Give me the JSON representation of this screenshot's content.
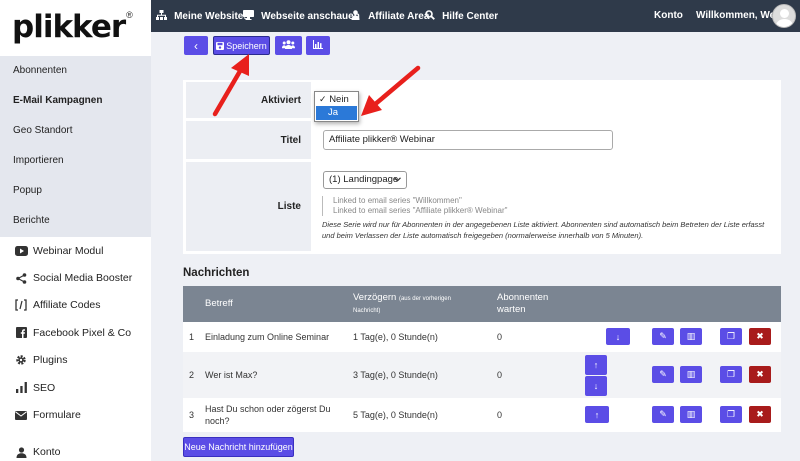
{
  "brand": {
    "logo_text": "plikker",
    "logo_mark": "®"
  },
  "sidebar": {
    "sub_items": [
      {
        "label": "Abonnenten"
      },
      {
        "label": "E-Mail Kampagnen",
        "active": true
      },
      {
        "label": "Geo Standort"
      },
      {
        "label": "Importieren"
      },
      {
        "label": "Popup"
      },
      {
        "label": "Berichte"
      }
    ],
    "main_items": [
      {
        "label": "Webinar Modul",
        "icon": "youtube-icon"
      },
      {
        "label": "Social Media Booster",
        "icon": "share-icon"
      },
      {
        "label": "Affiliate Codes",
        "icon": "brackets-icon"
      },
      {
        "label": "Facebook Pixel & Co",
        "icon": "facebook-icon"
      },
      {
        "label": "Plugins",
        "icon": "gear-icon"
      },
      {
        "label": "SEO",
        "icon": "bar-chart-icon"
      },
      {
        "label": "Formulare",
        "icon": "envelope-icon"
      },
      {
        "label": "Konto",
        "icon": "user-icon"
      }
    ]
  },
  "topnav": {
    "items": [
      {
        "label": "Meine Websites",
        "icon": "sitemap-icon"
      },
      {
        "label": "Webseite anschauen",
        "icon": "monitor-icon"
      },
      {
        "label": "Affiliate Area",
        "icon": "users-icon"
      },
      {
        "label": "Hilfe Center",
        "icon": "search-icon"
      }
    ],
    "konto": "Konto",
    "welcome": "Willkommen, Werner"
  },
  "toolbar": {
    "back_glyph": "‹",
    "save_label": "Speichern"
  },
  "form": {
    "aktiviert_label": "Aktiviert",
    "aktiviert_options": [
      "Nein",
      "Ja"
    ],
    "aktiviert_checked": "Nein",
    "aktiviert_highlighted": "Ja",
    "titel_label": "Titel",
    "titel_value": "Affiliate plikker® Webinar",
    "liste_label": "Liste",
    "liste_value": "(1) Landingpage",
    "linked_1": "Linked to email series \"Willkommen\"",
    "linked_2": "Linked to email series \"Affiliate plikker® Webinar\"",
    "note": "Diese Serie wird nur für Abonnenten in der angegebenen Liste aktiviert. Abonnenten sind automatisch beim Betreten der Liste erfasst und beim Verlassen der Liste automatisch freigegeben (normalerweise innerhalb von 5 Minuten)."
  },
  "messages": {
    "title": "Nachrichten",
    "headers": {
      "betreff": "Betreff",
      "verzoegern": "Verzögern",
      "verzoegern_note": "(aus der vorherigen",
      "verzoegern_note2": "Nachricht)",
      "abonnenten": "Abonnenten",
      "warten": "warten"
    },
    "rows": [
      {
        "num": "1",
        "subject": "Einladung zum Online Seminar",
        "subject2": "",
        "delay": "1 Tag(e), 0 Stunde(n)",
        "waiting": "0"
      },
      {
        "num": "2",
        "subject": "Wer ist Max?",
        "subject2": "",
        "delay": "3 Tag(e), 0 Stunde(n)",
        "waiting": "0"
      },
      {
        "num": "3",
        "subject": "Hast Du schon oder zögerst Du",
        "subject2": "noch?",
        "delay": "5 Tag(e), 0 Stunde(n)",
        "waiting": "0"
      }
    ],
    "add_label": "Neue Nachricht hinzufügen"
  },
  "colors": {
    "accent": "#5b4de6",
    "danger": "#a81b1b",
    "nav": "#2f3a4a",
    "arrow": "#e8201c"
  }
}
